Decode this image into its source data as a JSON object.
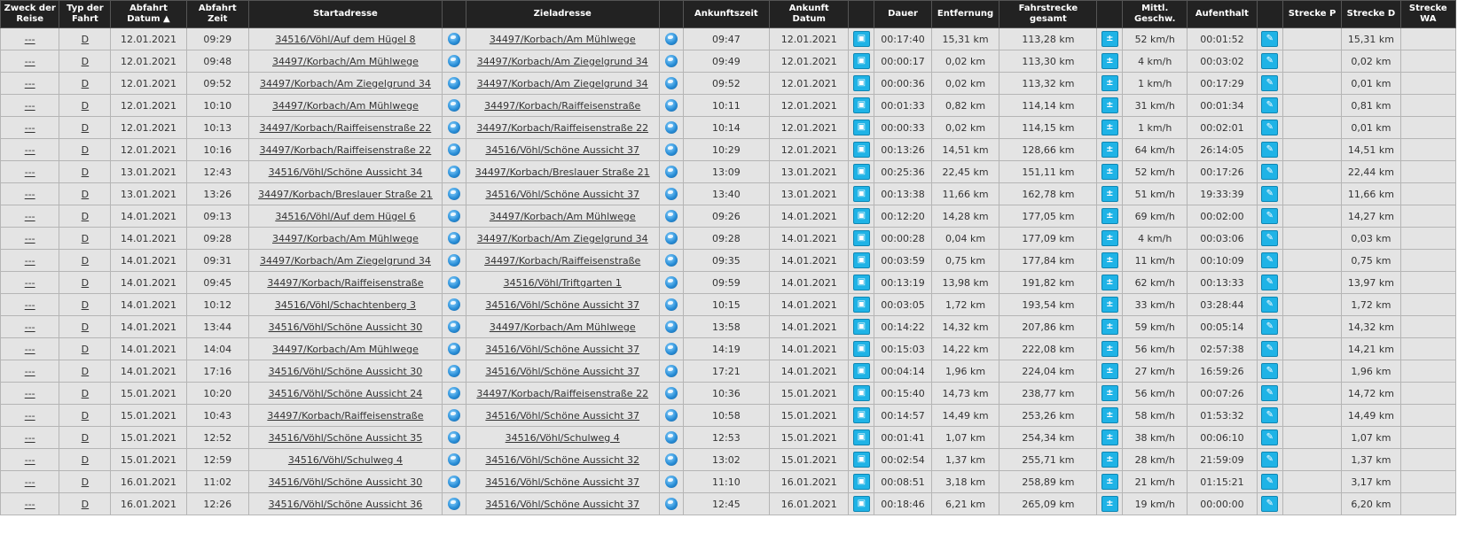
{
  "headers": [
    "Zweck der Reise",
    "Typ der Fahrt",
    "Abfahrt Datum ▲",
    "Abfahrt Zeit",
    "Startadresse",
    "",
    "Zieladresse",
    "",
    "Ankunftszeit",
    "Ankunft Datum",
    "",
    "Dauer",
    "Entfernung",
    "Fahrstrecke gesamt",
    "",
    "Mittl. Geschw.",
    "Aufenthalt",
    "",
    "Strecke P",
    "Strecke D",
    "Strecke WA"
  ],
  "icons": {
    "map": "globe-icon",
    "details": "car-icon",
    "calc": "plus-minus-icon",
    "edit": "pencil-icon"
  },
  "rows": [
    {
      "zweck": "---",
      "typ": "D",
      "ab_datum": "12.01.2021",
      "ab_zeit": "09:29",
      "start_plz": "34516",
      "start_rest": "/Vöhl/Auf dem Hügel 8",
      "ziel_plz": "34497",
      "ziel_rest": "/Korbach/Am Mühlwege",
      "an_zeit": "09:47",
      "an_datum": "12.01.2021",
      "dauer": "00:17:40",
      "entfernung": "15,31 km",
      "gesamt": "113,28 km",
      "geschw": "52 km/h",
      "aufenthalt": "00:01:52",
      "strecke_p": "",
      "strecke_d": "15,31 km",
      "strecke_wa": ""
    },
    {
      "zweck": "---",
      "typ": "D",
      "ab_datum": "12.01.2021",
      "ab_zeit": "09:48",
      "start_plz": "34497",
      "start_rest": "/Korbach/Am Mühlwege",
      "ziel_plz": "34497",
      "ziel_rest": "/Korbach/Am Ziegelgrund 34",
      "an_zeit": "09:49",
      "an_datum": "12.01.2021",
      "dauer": "00:00:17",
      "entfernung": "0,02 km",
      "gesamt": "113,30 km",
      "geschw": "4 km/h",
      "aufenthalt": "00:03:02",
      "strecke_p": "",
      "strecke_d": "0,02 km",
      "strecke_wa": ""
    },
    {
      "zweck": "---",
      "typ": "D",
      "ab_datum": "12.01.2021",
      "ab_zeit": "09:52",
      "start_plz": "34497",
      "start_rest": "/Korbach/Am Ziegelgrund 34",
      "ziel_plz": "34497",
      "ziel_rest": "/Korbach/Am Ziegelgrund 34",
      "an_zeit": "09:52",
      "an_datum": "12.01.2021",
      "dauer": "00:00:36",
      "entfernung": "0,02 km",
      "gesamt": "113,32 km",
      "geschw": "1 km/h",
      "aufenthalt": "00:17:29",
      "strecke_p": "",
      "strecke_d": "0,01 km",
      "strecke_wa": ""
    },
    {
      "zweck": "---",
      "typ": "D",
      "ab_datum": "12.01.2021",
      "ab_zeit": "10:10",
      "start_plz": "34497",
      "start_rest": "/Korbach/Am Mühlwege",
      "ziel_plz": "34497",
      "ziel_rest": "/Korbach/Raiffeisenstraße",
      "an_zeit": "10:11",
      "an_datum": "12.01.2021",
      "dauer": "00:01:33",
      "entfernung": "0,82 km",
      "gesamt": "114,14 km",
      "geschw": "31 km/h",
      "aufenthalt": "00:01:34",
      "strecke_p": "",
      "strecke_d": "0,81 km",
      "strecke_wa": ""
    },
    {
      "zweck": "---",
      "typ": "D",
      "ab_datum": "12.01.2021",
      "ab_zeit": "10:13",
      "start_plz": "34497",
      "start_rest": "/Korbach/Raiffeisenstraße 22",
      "ziel_plz": "34497",
      "ziel_rest": "/Korbach/Raiffeisenstraße 22",
      "an_zeit": "10:14",
      "an_datum": "12.01.2021",
      "dauer": "00:00:33",
      "entfernung": "0,02 km",
      "gesamt": "114,15 km",
      "geschw": "1 km/h",
      "aufenthalt": "00:02:01",
      "strecke_p": "",
      "strecke_d": "0,01 km",
      "strecke_wa": ""
    },
    {
      "zweck": "---",
      "typ": "D",
      "ab_datum": "12.01.2021",
      "ab_zeit": "10:16",
      "start_plz": "34497",
      "start_rest": "/Korbach/Raiffeisenstraße 22",
      "ziel_plz": "34516",
      "ziel_rest": "/Vöhl/Schöne Aussicht 37",
      "an_zeit": "10:29",
      "an_datum": "12.01.2021",
      "dauer": "00:13:26",
      "entfernung": "14,51 km",
      "gesamt": "128,66 km",
      "geschw": "64 km/h",
      "aufenthalt": "26:14:05",
      "strecke_p": "",
      "strecke_d": "14,51 km",
      "strecke_wa": ""
    },
    {
      "zweck": "---",
      "typ": "D",
      "ab_datum": "13.01.2021",
      "ab_zeit": "12:43",
      "start_plz": "34516",
      "start_rest": "/Vöhl/Schöne Aussicht 34",
      "ziel_plz": "34497",
      "ziel_rest": "/Korbach/Breslauer Straße 21",
      "an_zeit": "13:09",
      "an_datum": "13.01.2021",
      "dauer": "00:25:36",
      "entfernung": "22,45 km",
      "gesamt": "151,11 km",
      "geschw": "52 km/h",
      "aufenthalt": "00:17:26",
      "strecke_p": "",
      "strecke_d": "22,44 km",
      "strecke_wa": ""
    },
    {
      "zweck": "---",
      "typ": "D",
      "ab_datum": "13.01.2021",
      "ab_zeit": "13:26",
      "start_plz": "34497",
      "start_rest": "/Korbach/Breslauer Straße 21",
      "ziel_plz": "34516",
      "ziel_rest": "/Vöhl/Schöne Aussicht 37",
      "an_zeit": "13:40",
      "an_datum": "13.01.2021",
      "dauer": "00:13:38",
      "entfernung": "11,66 km",
      "gesamt": "162,78 km",
      "geschw": "51 km/h",
      "aufenthalt": "19:33:39",
      "strecke_p": "",
      "strecke_d": "11,66 km",
      "strecke_wa": ""
    },
    {
      "zweck": "---",
      "typ": "D",
      "ab_datum": "14.01.2021",
      "ab_zeit": "09:13",
      "start_plz": "34516",
      "start_rest": "/Vöhl/Auf dem Hügel 6",
      "ziel_plz": "34497",
      "ziel_rest": "/Korbach/Am Mühlwege",
      "an_zeit": "09:26",
      "an_datum": "14.01.2021",
      "dauer": "00:12:20",
      "entfernung": "14,28 km",
      "gesamt": "177,05 km",
      "geschw": "69 km/h",
      "aufenthalt": "00:02:00",
      "strecke_p": "",
      "strecke_d": "14,27 km",
      "strecke_wa": ""
    },
    {
      "zweck": "---",
      "typ": "D",
      "ab_datum": "14.01.2021",
      "ab_zeit": "09:28",
      "start_plz": "34497",
      "start_rest": "/Korbach/Am Mühlwege",
      "ziel_plz": "34497",
      "ziel_rest": "/Korbach/Am Ziegelgrund 34",
      "an_zeit": "09:28",
      "an_datum": "14.01.2021",
      "dauer": "00:00:28",
      "entfernung": "0,04 km",
      "gesamt": "177,09 km",
      "geschw": "4 km/h",
      "aufenthalt": "00:03:06",
      "strecke_p": "",
      "strecke_d": "0,03 km",
      "strecke_wa": ""
    },
    {
      "zweck": "---",
      "typ": "D",
      "ab_datum": "14.01.2021",
      "ab_zeit": "09:31",
      "start_plz": "34497",
      "start_rest": "/Korbach/Am Ziegelgrund 34",
      "ziel_plz": "34497",
      "ziel_rest": "/Korbach/Raiffeisenstraße",
      "an_zeit": "09:35",
      "an_datum": "14.01.2021",
      "dauer": "00:03:59",
      "entfernung": "0,75 km",
      "gesamt": "177,84 km",
      "geschw": "11 km/h",
      "aufenthalt": "00:10:09",
      "strecke_p": "",
      "strecke_d": "0,75 km",
      "strecke_wa": ""
    },
    {
      "zweck": "---",
      "typ": "D",
      "ab_datum": "14.01.2021",
      "ab_zeit": "09:45",
      "start_plz": "34497",
      "start_rest": "/Korbach/Raiffeisenstraße",
      "ziel_plz": "34516",
      "ziel_rest": "/Vöhl/Triftgarten 1",
      "an_zeit": "09:59",
      "an_datum": "14.01.2021",
      "dauer": "00:13:19",
      "entfernung": "13,98 km",
      "gesamt": "191,82 km",
      "geschw": "62 km/h",
      "aufenthalt": "00:13:33",
      "strecke_p": "",
      "strecke_d": "13,97 km",
      "strecke_wa": ""
    },
    {
      "zweck": "---",
      "typ": "D",
      "ab_datum": "14.01.2021",
      "ab_zeit": "10:12",
      "start_plz": "34516",
      "start_rest": "/Vöhl/Schachtenberg 3",
      "ziel_plz": "34516",
      "ziel_rest": "/Vöhl/Schöne Aussicht 37",
      "an_zeit": "10:15",
      "an_datum": "14.01.2021",
      "dauer": "00:03:05",
      "entfernung": "1,72 km",
      "gesamt": "193,54 km",
      "geschw": "33 km/h",
      "aufenthalt": "03:28:44",
      "strecke_p": "",
      "strecke_d": "1,72 km",
      "strecke_wa": ""
    },
    {
      "zweck": "---",
      "typ": "D",
      "ab_datum": "14.01.2021",
      "ab_zeit": "13:44",
      "start_plz": "34516",
      "start_rest": "/Vöhl/Schöne Aussicht 30",
      "ziel_plz": "34497",
      "ziel_rest": "/Korbach/Am Mühlwege",
      "an_zeit": "13:58",
      "an_datum": "14.01.2021",
      "dauer": "00:14:22",
      "entfernung": "14,32 km",
      "gesamt": "207,86 km",
      "geschw": "59 km/h",
      "aufenthalt": "00:05:14",
      "strecke_p": "",
      "strecke_d": "14,32 km",
      "strecke_wa": ""
    },
    {
      "zweck": "---",
      "typ": "D",
      "ab_datum": "14.01.2021",
      "ab_zeit": "14:04",
      "start_plz": "34497",
      "start_rest": "/Korbach/Am Mühlwege",
      "ziel_plz": "34516",
      "ziel_rest": "/Vöhl/Schöne Aussicht 37",
      "an_zeit": "14:19",
      "an_datum": "14.01.2021",
      "dauer": "00:15:03",
      "entfernung": "14,22 km",
      "gesamt": "222,08 km",
      "geschw": "56 km/h",
      "aufenthalt": "02:57:38",
      "strecke_p": "",
      "strecke_d": "14,21 km",
      "strecke_wa": ""
    },
    {
      "zweck": "---",
      "typ": "D",
      "ab_datum": "14.01.2021",
      "ab_zeit": "17:16",
      "start_plz": "34516",
      "start_rest": "/Vöhl/Schöne Aussicht 30",
      "ziel_plz": "34516",
      "ziel_rest": "/Vöhl/Schöne Aussicht 37",
      "an_zeit": "17:21",
      "an_datum": "14.01.2021",
      "dauer": "00:04:14",
      "entfernung": "1,96 km",
      "gesamt": "224,04 km",
      "geschw": "27 km/h",
      "aufenthalt": "16:59:26",
      "strecke_p": "",
      "strecke_d": "1,96 km",
      "strecke_wa": ""
    },
    {
      "zweck": "---",
      "typ": "D",
      "ab_datum": "15.01.2021",
      "ab_zeit": "10:20",
      "start_plz": "34516",
      "start_rest": "/Vöhl/Schöne Aussicht 24",
      "ziel_plz": "34497",
      "ziel_rest": "/Korbach/Raiffeisenstraße 22",
      "an_zeit": "10:36",
      "an_datum": "15.01.2021",
      "dauer": "00:15:40",
      "entfernung": "14,73 km",
      "gesamt": "238,77 km",
      "geschw": "56 km/h",
      "aufenthalt": "00:07:26",
      "strecke_p": "",
      "strecke_d": "14,72 km",
      "strecke_wa": ""
    },
    {
      "zweck": "---",
      "typ": "D",
      "ab_datum": "15.01.2021",
      "ab_zeit": "10:43",
      "start_plz": "34497",
      "start_rest": "/Korbach/Raiffeisenstraße",
      "ziel_plz": "34516",
      "ziel_rest": "/Vöhl/Schöne Aussicht 37",
      "an_zeit": "10:58",
      "an_datum": "15.01.2021",
      "dauer": "00:14:57",
      "entfernung": "14,49 km",
      "gesamt": "253,26 km",
      "geschw": "58 km/h",
      "aufenthalt": "01:53:32",
      "strecke_p": "",
      "strecke_d": "14,49 km",
      "strecke_wa": ""
    },
    {
      "zweck": "---",
      "typ": "D",
      "ab_datum": "15.01.2021",
      "ab_zeit": "12:52",
      "start_plz": "34516",
      "start_rest": "/Vöhl/Schöne Aussicht 35",
      "ziel_plz": "34516",
      "ziel_rest": "/Vöhl/Schulweg 4",
      "an_zeit": "12:53",
      "an_datum": "15.01.2021",
      "dauer": "00:01:41",
      "entfernung": "1,07 km",
      "gesamt": "254,34 km",
      "geschw": "38 km/h",
      "aufenthalt": "00:06:10",
      "strecke_p": "",
      "strecke_d": "1,07 km",
      "strecke_wa": ""
    },
    {
      "zweck": "---",
      "typ": "D",
      "ab_datum": "15.01.2021",
      "ab_zeit": "12:59",
      "start_plz": "34516",
      "start_rest": "/Vöhl/Schulweg 4",
      "ziel_plz": "34516",
      "ziel_rest": "/Vöhl/Schöne Aussicht 32",
      "an_zeit": "13:02",
      "an_datum": "15.01.2021",
      "dauer": "00:02:54",
      "entfernung": "1,37 km",
      "gesamt": "255,71 km",
      "geschw": "28 km/h",
      "aufenthalt": "21:59:09",
      "strecke_p": "",
      "strecke_d": "1,37 km",
      "strecke_wa": ""
    },
    {
      "zweck": "---",
      "typ": "D",
      "ab_datum": "16.01.2021",
      "ab_zeit": "11:02",
      "start_plz": "34516",
      "start_rest": "/Vöhl/Schöne Aussicht 30",
      "ziel_plz": "34516",
      "ziel_rest": "/Vöhl/Schöne Aussicht 37",
      "an_zeit": "11:10",
      "an_datum": "16.01.2021",
      "dauer": "00:08:51",
      "entfernung": "3,18 km",
      "gesamt": "258,89 km",
      "geschw": "21 km/h",
      "aufenthalt": "01:15:21",
      "strecke_p": "",
      "strecke_d": "3,17 km",
      "strecke_wa": ""
    },
    {
      "zweck": "---",
      "typ": "D",
      "ab_datum": "16.01.2021",
      "ab_zeit": "12:26",
      "start_plz": "34516",
      "start_rest": "/Vöhl/Schöne Aussicht 36",
      "ziel_plz": "34516",
      "ziel_rest": "/Vöhl/Schöne Aussicht 37",
      "an_zeit": "12:45",
      "an_datum": "16.01.2021",
      "dauer": "00:18:46",
      "entfernung": "6,21 km",
      "gesamt": "265,09 km",
      "geschw": "19 km/h",
      "aufenthalt": "00:00:00",
      "strecke_p": "",
      "strecke_d": "6,20 km",
      "strecke_wa": ""
    }
  ]
}
